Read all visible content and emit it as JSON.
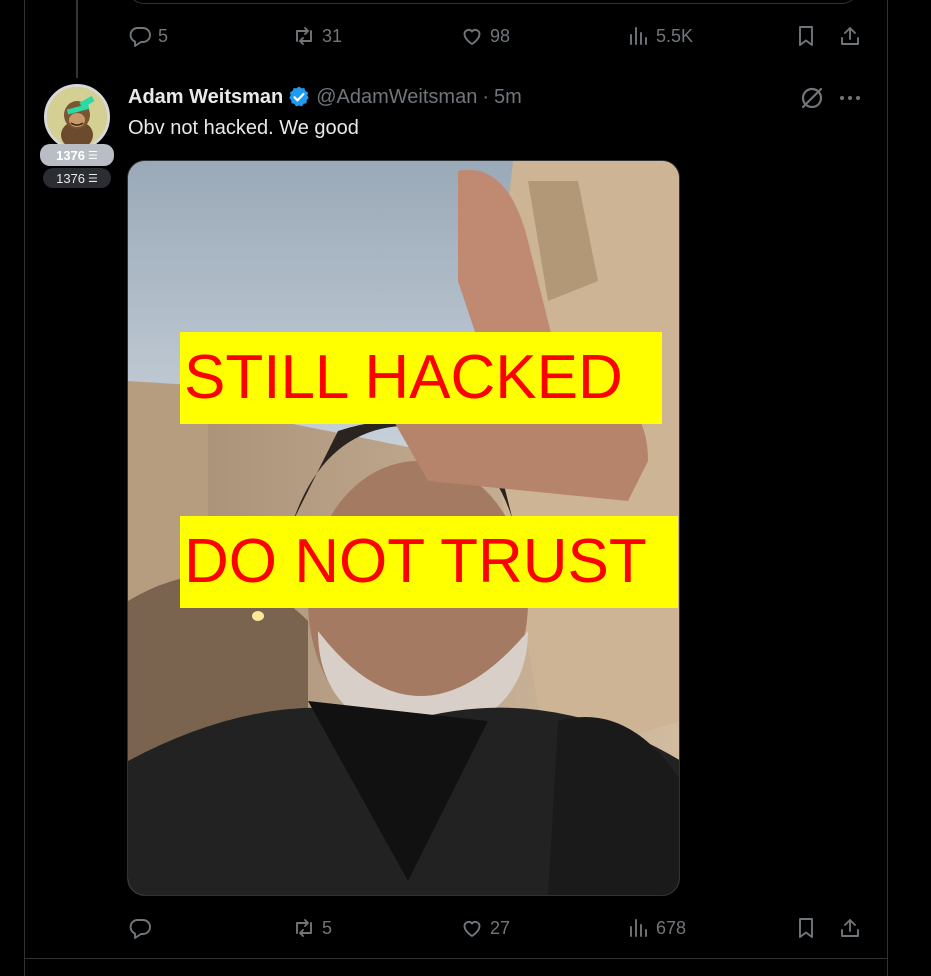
{
  "prev_tweet": {
    "actions": {
      "replies": "5",
      "reposts": "31",
      "likes": "98",
      "views": "5.5K"
    }
  },
  "tweet": {
    "author": {
      "name": "Adam Weitsman",
      "handle": "@AdamWeitsman",
      "verified": true,
      "avatar_badge_top": "1376",
      "avatar_badge_bottom": "1376"
    },
    "separator": "·",
    "timestamp": "5m",
    "text": "Obv not hacked. We good",
    "image_overlay": {
      "line1": "STILL HACKED",
      "line2": "DO NOT TRUST"
    },
    "actions": {
      "replies": "",
      "reposts": "5",
      "likes": "27",
      "views": "678"
    }
  },
  "colors": {
    "background": "#000000",
    "text_primary": "#e7e9ea",
    "text_secondary": "#71767b",
    "verified_blue": "#1d9bf0",
    "overlay_bg": "#ffff00",
    "overlay_text": "#ff0000"
  },
  "icons": [
    "reply-icon",
    "repost-icon",
    "like-icon",
    "views-icon",
    "bookmark-icon",
    "share-icon",
    "verified-icon",
    "grok-icon",
    "more-icon"
  ]
}
